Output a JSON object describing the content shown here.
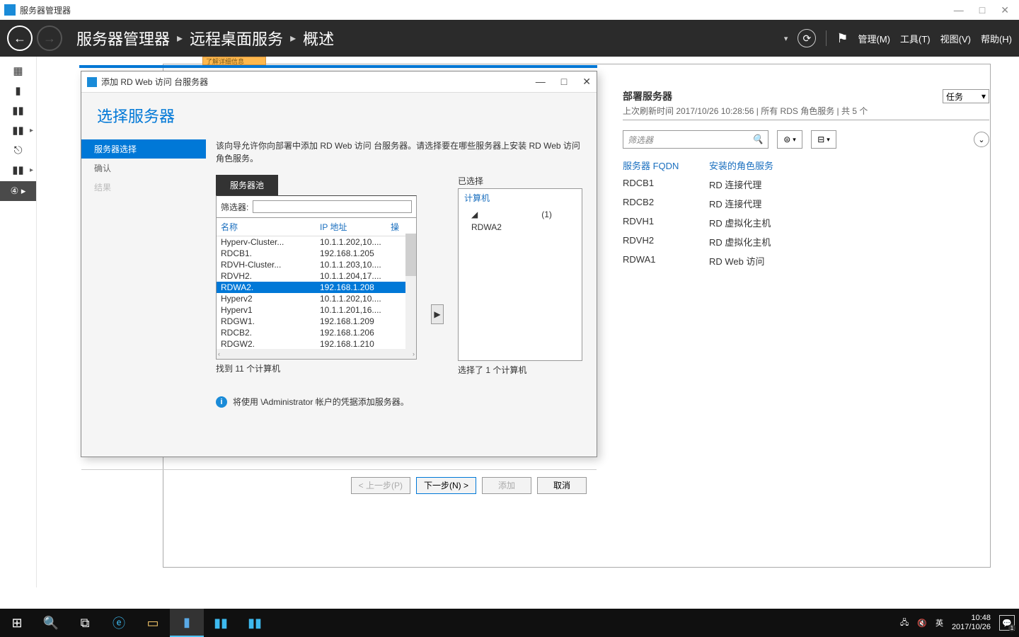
{
  "app_title": "服务器管理器",
  "window_controls": {
    "min": "—",
    "max": "□",
    "close": "✕"
  },
  "breadcrumb": {
    "root": "服务器管理器",
    "sep": "▸",
    "l1": "远程桌面服务",
    "l2": "概述"
  },
  "header_menu": {
    "manage": "管理(M)",
    "tools": "工具(T)",
    "view": "视图(V)",
    "help": "帮助(H)"
  },
  "dialog": {
    "title": "添加 RD Web 访问 台服务器",
    "heading": "选择服务器",
    "steps": {
      "select": "服务器选择",
      "confirm": "确认",
      "result": "结果"
    },
    "desc": "该向导允许你向部署中添加 RD Web 访问 台服务器。请选择要在哪些服务器上安装 RD Web 访问 角色服务。",
    "pool_tab": "服务器池",
    "filter_label": "筛选器:",
    "col_name": "名称",
    "col_ip": "IP 地址",
    "col_os": "操",
    "rows": [
      {
        "name": "Hyperv-Cluster...",
        "ip": "10.1.1.202,10...."
      },
      {
        "name": "RDCB1.",
        "ip": "192.168.1.205"
      },
      {
        "name": "RDVH-Cluster...",
        "ip": "10.1.1.203,10...."
      },
      {
        "name": "RDVH2.",
        "ip": "10.1.1.204,17...."
      },
      {
        "name": "RDWA2.",
        "ip": "192.168.1.208",
        "sel": true
      },
      {
        "name": "Hyperv2",
        "ip": "10.1.1.202,10...."
      },
      {
        "name": "Hyperv1",
        "ip": "10.1.1.201,16...."
      },
      {
        "name": "RDGW1.",
        "ip": "192.168.1.209"
      },
      {
        "name": "RDCB2.",
        "ip": "192.168.1.206"
      },
      {
        "name": "RDGW2.",
        "ip": "192.168.1.210"
      }
    ],
    "found": "找到 11 个计算机",
    "selected_label": "已选择",
    "selected_header": "计算机",
    "selected_count_inline": "(1)",
    "selected_item": "RDWA2",
    "selected_count": "选择了 1 个计算机",
    "info": "将使用              \\Administrator 帐户的凭据添加服务器。",
    "btn_prev": "< 上一步(P)",
    "btn_next": "下一步(N) >",
    "btn_add": "添加",
    "btn_cancel": "取消"
  },
  "deploy": {
    "title": "部署服务器",
    "subtitle": "上次刷新时间 2017/10/26 10:28:56 | 所有 RDS 角色服务 | 共 5 个",
    "task": "任务",
    "filter_placeholder": "筛选器",
    "col_fqdn": "服务器 FQDN",
    "col_role": "安装的角色服务",
    "rows": [
      {
        "fqdn": "RDCB1",
        "role": "RD 连接代理"
      },
      {
        "fqdn": "RDCB2",
        "role": "RD 连接代理"
      },
      {
        "fqdn": "RDVH1",
        "role": "RD 虚拟化主机"
      },
      {
        "fqdn": "RDVH2",
        "role": "RD 虚拟化主机"
      },
      {
        "fqdn": "RDWA1",
        "role": "RD Web 访问"
      }
    ]
  },
  "yellow_strip": "了解详细信息",
  "taskbar": {
    "ime": "英",
    "time": "10:48",
    "date": "2017/10/26"
  }
}
